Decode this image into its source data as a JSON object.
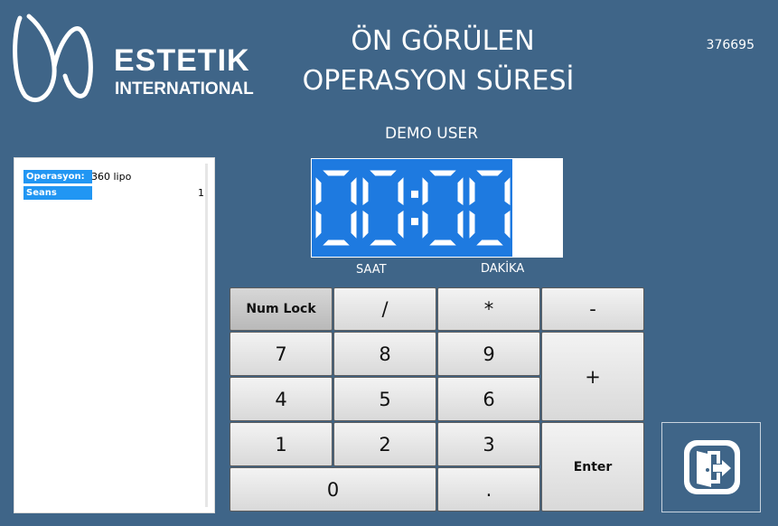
{
  "brand": {
    "line1": "ESTETIK",
    "line2": "INTERNATIONAL"
  },
  "title": {
    "line1": "ÖN GÖRÜLEN",
    "line2": "OPERASYON SÜRESİ"
  },
  "code": "376695",
  "user": "DEMO USER",
  "info": [
    {
      "label": "Operasyon:",
      "value": "360 lipo"
    },
    {
      "label": "Seans Sayısı:",
      "value": "1"
    }
  ],
  "clock": {
    "display": "00:00",
    "hours_label": "SAAT",
    "minutes_label": "DAKİKA"
  },
  "keypad": {
    "numlock": "Num Lock",
    "divide": "/",
    "multiply": "*",
    "minus": "-",
    "k7": "7",
    "k8": "8",
    "k9": "9",
    "plus": "+",
    "k4": "4",
    "k5": "5",
    "k6": "6",
    "k1": "1",
    "k2": "2",
    "k3": "3",
    "enter": "Enter",
    "k0": "0",
    "dot": "."
  },
  "icons": {
    "logo": "estetik-logo",
    "exit": "exit-door-icon"
  },
  "colors": {
    "background": "#3f6588",
    "accent": "#2196f3",
    "clock": "#1e7ae0"
  }
}
